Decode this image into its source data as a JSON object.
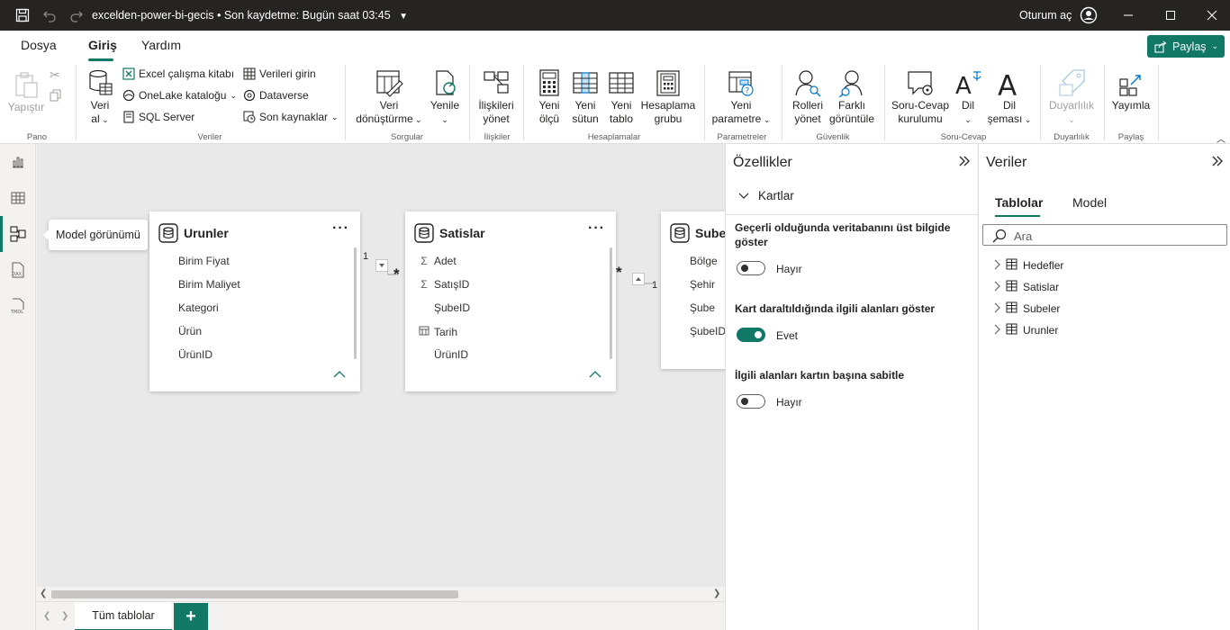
{
  "titlebar": {
    "doc_title": "excelden-power-bi-gecis",
    "save_status": "Son kaydetme: Bugün saat 03:45",
    "signin": "Oturum aç"
  },
  "menu": {
    "tabs": [
      {
        "label": "Dosya"
      },
      {
        "label": "Giriş"
      },
      {
        "label": "Yardım"
      }
    ],
    "share_label": "Paylaş"
  },
  "ribbon": {
    "paste": "Yapıştır",
    "get_data_1": "Veri",
    "get_data_2": "al",
    "excel": "Excel çalışma kitabı",
    "onelake": "OneLake kataloğu",
    "sql": "SQL Server",
    "enter_data": "Verileri girin",
    "dataverse": "Dataverse",
    "recent": "Son kaynaklar",
    "transform_1": "Veri",
    "transform_2": "dönüştürme",
    "refresh": "Yenile",
    "rel_1": "İlişkileri",
    "rel_2": "yönet",
    "measure_1": "Yeni",
    "measure_2": "ölçü",
    "column_1": "Yeni",
    "column_2": "sütun",
    "table_1": "Yeni",
    "table_2": "tablo",
    "calcgroup_1": "Hesaplama",
    "calcgroup_2": "grubu",
    "param_1": "Yeni",
    "param_2": "parametre",
    "roles_1": "Rolleri",
    "roles_2": "yönet",
    "viewas_1": "Farklı",
    "viewas_2": "görüntüle",
    "qa_1": "Soru-Cevap",
    "qa_2": "kurulumu",
    "lang": "Dil",
    "schema_1": "Dil",
    "schema_2": "şeması",
    "sensitivity": "Duyarlılık",
    "publish": "Yayımla",
    "groups": {
      "pano": "Pano",
      "veriler": "Veriler",
      "sorgular": "Sorgular",
      "iliskiler": "İlişkiler",
      "hesaplamalar": "Hesaplamalar",
      "parametreler": "Parametreler",
      "guvenlik": "Güvenlik",
      "soru_cevap": "Soru-Cevap",
      "duyarlilik": "Duyarlılık",
      "paylas": "Paylaş"
    }
  },
  "rail": {
    "tooltip": "Model görünümü"
  },
  "canvas": {
    "tables": [
      {
        "name": "Urunler",
        "fields": [
          {
            "label": "Birim Fiyat",
            "icon": ""
          },
          {
            "label": "Birim Maliyet",
            "icon": ""
          },
          {
            "label": "Kategori",
            "icon": ""
          },
          {
            "label": "Ürün",
            "icon": ""
          },
          {
            "label": "ÜrünID",
            "icon": ""
          }
        ]
      },
      {
        "name": "Satislar",
        "fields": [
          {
            "label": "Adet",
            "icon": "Σ"
          },
          {
            "label": "SatışID",
            "icon": "Σ"
          },
          {
            "label": "ŞubeID",
            "icon": ""
          },
          {
            "label": "Tarih",
            "icon": "calendar-icon"
          },
          {
            "label": "ÜrünID",
            "icon": ""
          }
        ]
      },
      {
        "name": "Subeler",
        "fields": [
          {
            "label": "Bölge",
            "icon": ""
          },
          {
            "label": "Şehir",
            "icon": ""
          },
          {
            "label": "Şube",
            "icon": ""
          },
          {
            "label": "ŞubeID",
            "icon": ""
          }
        ]
      }
    ],
    "rel_one_left": "1",
    "rel_many_left": "*",
    "rel_many_right": "*",
    "rel_one_right": "1",
    "more": "···"
  },
  "bottom": {
    "tab_label": "Tüm tablolar",
    "add_label": "+"
  },
  "properties": {
    "title": "Özellikler",
    "section": "Kartlar",
    "options": [
      {
        "label": "Geçerli olduğunda veritabanını üst bilgide göster",
        "value": "Hayır",
        "on": false
      },
      {
        "label": "Kart daraltıldığında ilgili alanları göster",
        "value": "Evet",
        "on": true
      },
      {
        "label": "İlgili alanları kartın başına sabitle",
        "value": "Hayır",
        "on": false
      }
    ]
  },
  "data_pane": {
    "title": "Veriler",
    "tabs": [
      {
        "label": "Tablolar"
      },
      {
        "label": "Model"
      }
    ],
    "search_placeholder": "Ara",
    "tables": [
      {
        "label": "Hedefler"
      },
      {
        "label": "Satislar"
      },
      {
        "label": "Subeler"
      },
      {
        "label": "Urunler"
      }
    ]
  },
  "colors": {
    "accent": "#117865",
    "titlebar": "#252423"
  }
}
